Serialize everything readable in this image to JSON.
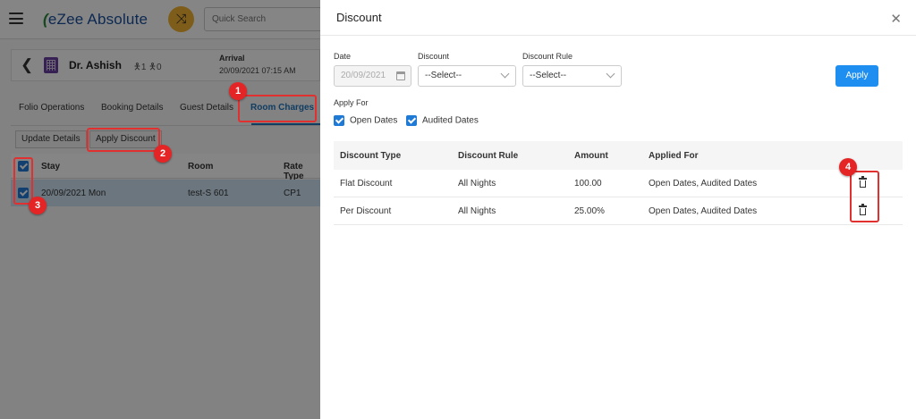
{
  "app": {
    "logo_text": "eZee Absolute",
    "search_placeholder": "Quick Search"
  },
  "guest": {
    "name": "Dr. Ashish",
    "adults": "1",
    "children": "0",
    "arrival_label": "Arrival",
    "arrival_value": "20/09/2021 07:15 AM"
  },
  "tabs": [
    {
      "label": "Folio Operations"
    },
    {
      "label": "Booking Details"
    },
    {
      "label": "Guest Details"
    },
    {
      "label": "Room Charges"
    }
  ],
  "actions": {
    "update_details": "Update Details",
    "apply_discount": "Apply Discount"
  },
  "grid": {
    "headers": [
      "Stay",
      "Room",
      "Rate Type"
    ],
    "rows": [
      {
        "stay": "20/09/2021 Mon",
        "room": "test-S 601",
        "rate_type": "CP1"
      }
    ]
  },
  "panel": {
    "title": "Discount",
    "date_label": "Date",
    "date_value": "20/09/2021",
    "discount_label": "Discount",
    "discount_value": "--Select--",
    "discount_rule_label": "Discount Rule",
    "discount_rule_value": "--Select--",
    "apply_button": "Apply",
    "apply_for_label": "Apply For",
    "open_dates": "Open Dates",
    "audited_dates": "Audited Dates",
    "table": {
      "headers": [
        "Discount Type",
        "Discount Rule",
        "Amount",
        "Applied For"
      ],
      "rows": [
        {
          "type": "Flat Discount",
          "rule": "All Nights",
          "amount": "100.00",
          "applied_for": "Open Dates, Audited Dates"
        },
        {
          "type": "Per Discount",
          "rule": "All Nights",
          "amount": "25.00%",
          "applied_for": "Open Dates, Audited Dates"
        }
      ]
    }
  },
  "callouts": [
    "1",
    "2",
    "3",
    "4"
  ],
  "colors": {
    "accent": "#1e8ff0",
    "callout": "#e52525",
    "active_tab": "#2176bd",
    "selected_row": "#cfe3f3"
  }
}
